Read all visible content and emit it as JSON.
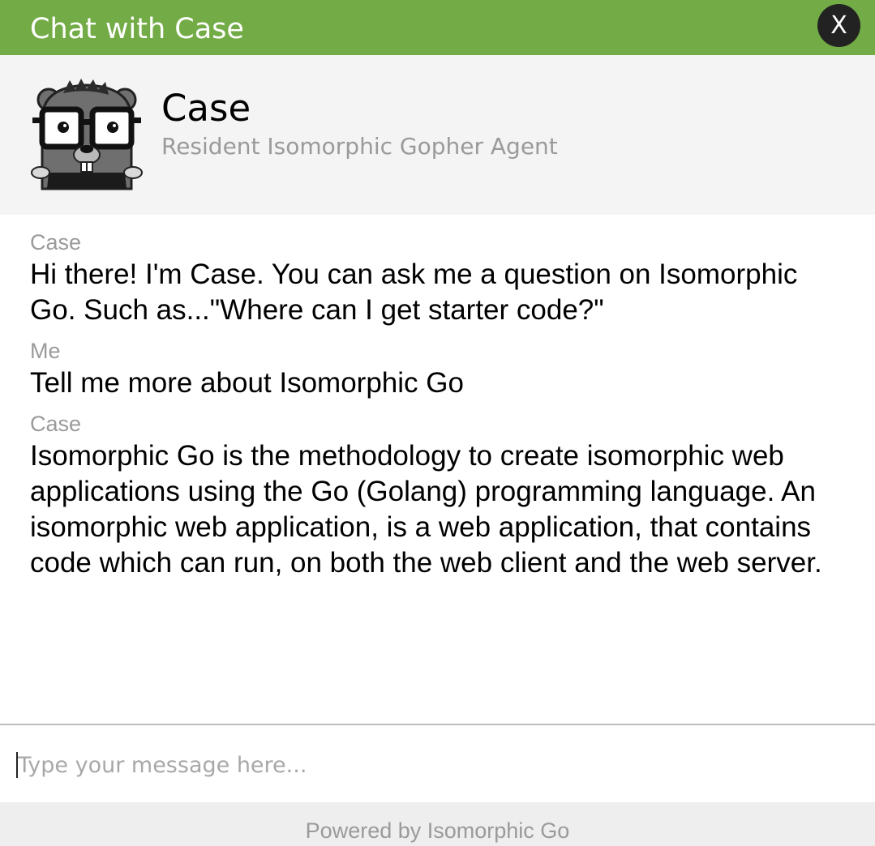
{
  "window": {
    "title": "Chat with Case",
    "close_label": "X"
  },
  "agent": {
    "name": "Case",
    "subtitle": "Resident Isomorphic Gopher Agent",
    "avatar_icon": "gopher-avatar-icon"
  },
  "messages": [
    {
      "sender": "Case",
      "text": "Hi there! I'm Case. You can ask me a question on Isomorphic Go. Such as...\"Where can I get starter code?\""
    },
    {
      "sender": "Me",
      "text": "Tell me more about Isomorphic Go"
    },
    {
      "sender": "Case",
      "text": "Isomorphic Go is the methodology to create isomorphic web applications using the Go (Golang) programming language. An isomorphic web application, is a web application, that contains code which can run, on both the web client and the web server."
    }
  ],
  "input": {
    "placeholder": "Type your message here...",
    "value": ""
  },
  "footer": {
    "text": "Powered by Isomorphic Go"
  },
  "colors": {
    "titlebar": "#73ac46",
    "close_button": "#222222",
    "header_bg": "#f4f4f4",
    "muted_text": "#9a9a9a"
  }
}
